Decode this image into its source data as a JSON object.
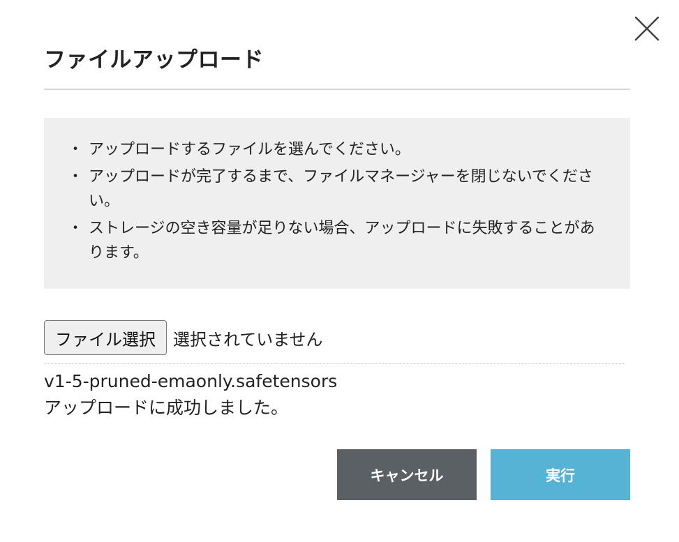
{
  "dialog": {
    "title": "ファイルアップロード",
    "close_icon": "close-icon"
  },
  "notes": {
    "bullet": "・",
    "items": [
      "アップロードするファイルを選んでください。",
      "アップロードが完了するまで、ファイルマネージャーを閉じないでください。",
      "ストレージの空き容量が足りない場合、アップロードに失敗することがあります。"
    ]
  },
  "file_input": {
    "button_label": "ファイル選択",
    "status_text": "選択されていません"
  },
  "result": {
    "filename": "v1-5-pruned-emaonly.safetensors",
    "message": "アップロードに成功しました。"
  },
  "actions": {
    "cancel_label": "キャンセル",
    "run_label": "実行"
  },
  "colors": {
    "cancel_bg": "#5a6064",
    "run_bg": "#55b4d6",
    "notes_bg": "#efeff0"
  }
}
